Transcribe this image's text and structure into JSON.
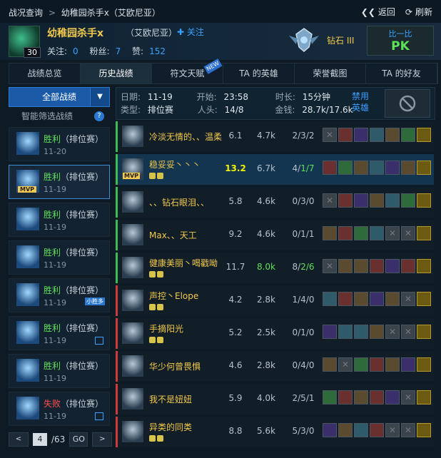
{
  "breadcrumb": {
    "root": "战况查询",
    "current": "幼稚园杀手x（艾欧尼亚）"
  },
  "actions": {
    "back": "返回",
    "refresh": "刷新"
  },
  "profile": {
    "level": "30",
    "name": "幼稚园杀手x",
    "server": "（艾欧尼亚）",
    "follow_label": "关注",
    "following_label": "关注:",
    "following": "0",
    "fans_label": "粉丝:",
    "fans": "7",
    "likes_label": "赞:",
    "likes": "152",
    "rank": "钻石 III",
    "pk_top": "比一比",
    "pk_bottom": "PK"
  },
  "tabs": [
    {
      "label": "战绩总览"
    },
    {
      "label": "历史战绩"
    },
    {
      "label": "符文天赋",
      "badge": "NEW"
    },
    {
      "label": "TA 的英雄"
    },
    {
      "label": "荣誉截图"
    },
    {
      "label": "TA 的好友"
    }
  ],
  "left": {
    "all_label": "全部战绩",
    "smart_label": "智能筛选战绩",
    "help": "?",
    "matches": [
      {
        "result": "胜利",
        "mode": "（排位赛）",
        "date": "11-20",
        "win": true
      },
      {
        "result": "胜利",
        "mode": "（排位赛）",
        "date": "11-19",
        "win": true,
        "mvp": "MVP",
        "selected": true
      },
      {
        "result": "胜利",
        "mode": "（排位赛）",
        "date": "11-19",
        "win": true
      },
      {
        "result": "胜利",
        "mode": "（排位赛）",
        "date": "11-19",
        "win": true
      },
      {
        "result": "胜利",
        "mode": "（排位赛）",
        "date": "11-19",
        "win": true,
        "tag": "小胜多"
      },
      {
        "result": "胜利",
        "mode": "（排位赛）",
        "date": "11-19",
        "win": true,
        "pic": true
      },
      {
        "result": "胜利",
        "mode": "（排位赛）",
        "date": "11-19",
        "win": true
      },
      {
        "result": "失败",
        "mode": "（排位赛）",
        "date": "11-19",
        "win": false,
        "pic": true
      }
    ],
    "pager": {
      "page": "4",
      "total": "/63",
      "go": "GO",
      "prev": "<",
      "next": ">"
    }
  },
  "summary": {
    "date_label": "日期:",
    "date": "11-19",
    "start_label": "开始:",
    "start": "23:58",
    "duration_label": "时长:",
    "duration": "15分钟",
    "type_label": "类型:",
    "type": "排位赛",
    "kills_label": "人头:",
    "kills": "14/8",
    "gold_label": "金钱:",
    "gold": "28.7k/17.6k",
    "ban_l1": "禁用",
    "ban_l2": "英雄"
  },
  "players": [
    {
      "name": "冷淡无情的、、温柔",
      "score": "6.1",
      "dmg": "4.7k",
      "kda": "2/3/2",
      "team": "green"
    },
    {
      "name": "稳妥妥丶丶丶",
      "score": "13.2",
      "dmg": "6.7k",
      "kda_a": "4/",
      "kda_b": "1/7",
      "team": "green",
      "mvp": "MVP",
      "highlight": true,
      "best_score": true
    },
    {
      "name": "、、钻石眼泪、、",
      "score": "5.8",
      "dmg": "4.6k",
      "kda": "0/3/0",
      "team": "green"
    },
    {
      "name": "Max、、天工",
      "score": "9.2",
      "dmg": "4.6k",
      "kda": "0/1/1",
      "team": "green"
    },
    {
      "name": "健康美丽丶喝戳呦",
      "score": "11.7",
      "dmg": "8.0k",
      "kda_a": "8/",
      "kda_b": "2/6",
      "team": "green",
      "best_dmg": true
    },
    {
      "name": "声控丶Elope",
      "score": "4.2",
      "dmg": "2.8k",
      "kda": "1/4/0",
      "team": "red"
    },
    {
      "name": "手摘阳光",
      "score": "5.2",
      "dmg": "2.5k",
      "kda": "0/1/0",
      "team": "red"
    },
    {
      "name": "华少何曾畏惧",
      "score": "4.6",
      "dmg": "2.8k",
      "kda": "0/4/0",
      "team": "red"
    },
    {
      "name": "我不是妞妞",
      "score": "5.9",
      "dmg": "4.0k",
      "kda": "2/5/1",
      "team": "red"
    },
    {
      "name": "异类的同类",
      "score": "8.8",
      "dmg": "5.6k",
      "kda": "5/3/0",
      "team": "red"
    }
  ]
}
